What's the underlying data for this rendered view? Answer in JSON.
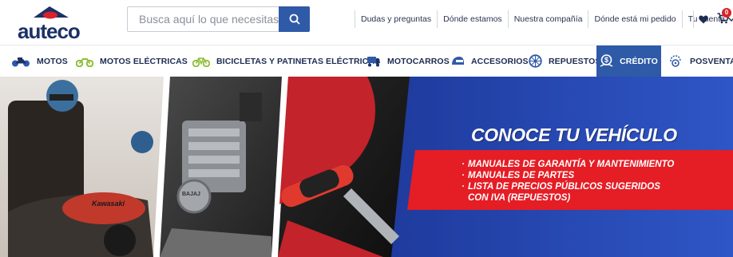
{
  "brand": {
    "name": "auteco",
    "colors": {
      "primary": "#2f5aa8",
      "dark": "#1c3166",
      "red": "#d8232a"
    }
  },
  "search": {
    "placeholder": "Busca aquí lo que necesitas...",
    "value": "",
    "icon": "search-icon"
  },
  "toplinks": [
    {
      "label": "Dudas y preguntas"
    },
    {
      "label": "Dónde estamos"
    },
    {
      "label": "Nuestra compañía"
    },
    {
      "label": "Dónde está mi pedido"
    },
    {
      "label": "Tu cuenta",
      "icon": "chevron-down-icon"
    }
  ],
  "wishlist": {
    "icon": "heart-icon"
  },
  "cart": {
    "icon": "cart-icon",
    "count": "0"
  },
  "nav": [
    {
      "label": "MOTOS",
      "icon": "motorcycle-icon"
    },
    {
      "label": "MOTOS ELÉCTRICAS",
      "icon": "electric-motorcycle-icon"
    },
    {
      "label": "BICICLETAS Y PATINETAS ELÉCTRICAS",
      "icon": "bicycle-icon"
    },
    {
      "label": "MOTOCARROS",
      "icon": "motocarro-icon"
    },
    {
      "label": "ACCESORIOS",
      "icon": "helmet-icon"
    },
    {
      "label": "REPUESTOS",
      "icon": "wheel-icon"
    },
    {
      "label": "CRÉDITO",
      "icon": "credit-icon",
      "active": true
    },
    {
      "label": "POSVENTA",
      "icon": "posventa-icon"
    }
  ],
  "banner": {
    "title": "CONOCE TU VEHÍCULO",
    "items": [
      "MANUALES DE GARANTÍA Y MANTENIMIENTO",
      "MANUALES DE PARTES",
      "LISTA DE PRECIOS PÚBLICOS SUGERIDOS",
      "CON IVA (REPUESTOS)"
    ],
    "photo_text_1": "Kawasaki",
    "photo_text_2": "BAJAJ"
  }
}
